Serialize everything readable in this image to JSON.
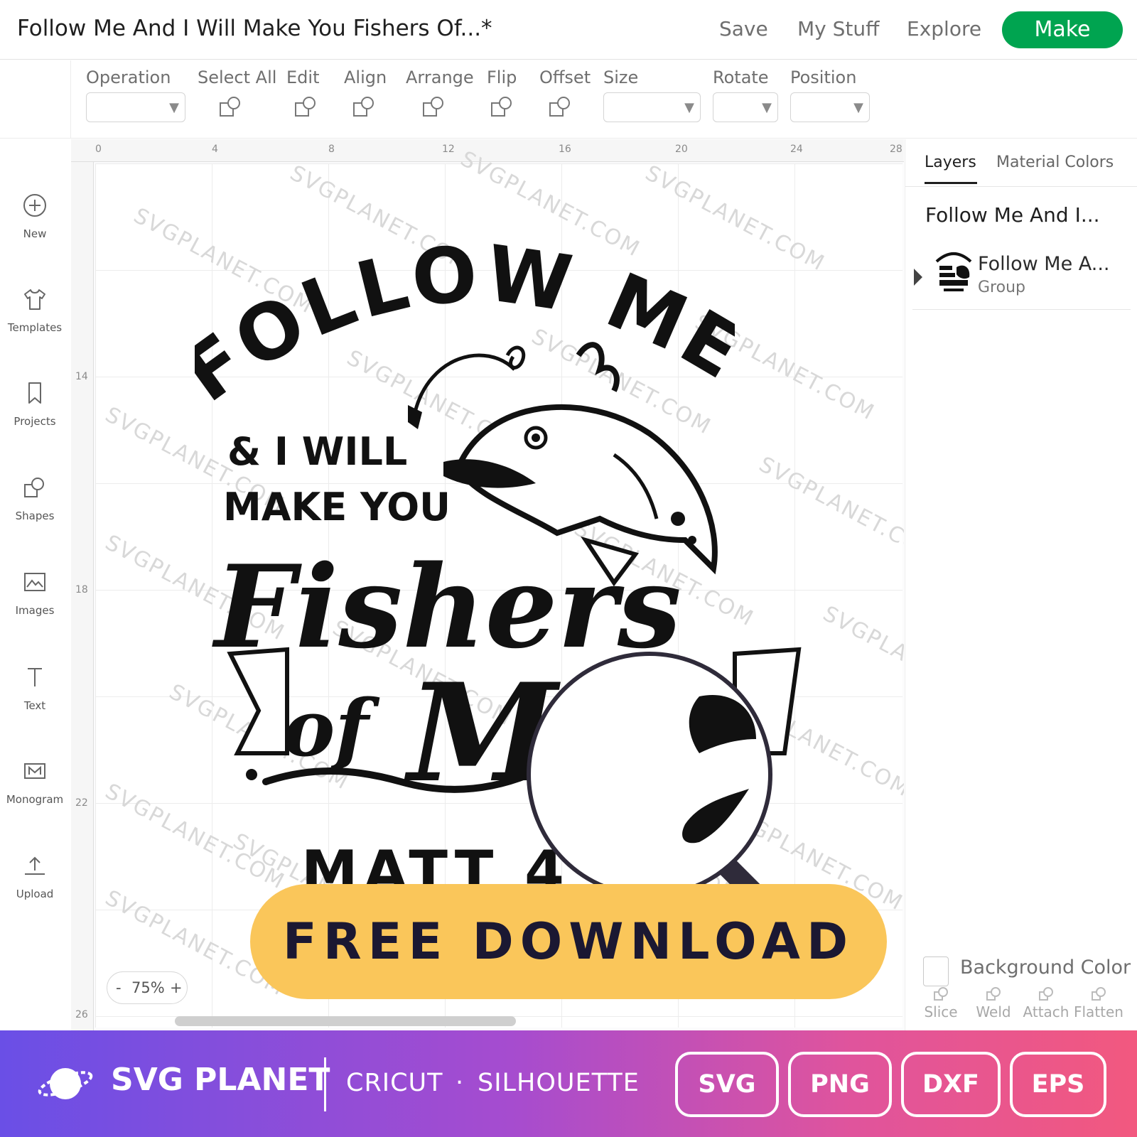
{
  "header": {
    "title": "Follow Me And I Will Make You Fishers Of...*",
    "nav": [
      "Save",
      "My Stuff",
      "Explore"
    ],
    "make_label": "Make",
    "accent_color": "#00a450"
  },
  "toolbar": {
    "labels": [
      "Operation",
      "Select All",
      "Edit",
      "Align",
      "Arrange",
      "Flip",
      "Offset",
      "Size",
      "Rotate",
      "Position"
    ]
  },
  "sidebar": {
    "items": [
      {
        "label": "New",
        "icon": "plus-circle-icon"
      },
      {
        "label": "Templates",
        "icon": "shirt-icon"
      },
      {
        "label": "Projects",
        "icon": "bookmark-icon"
      },
      {
        "label": "Shapes",
        "icon": "shapes-icon"
      },
      {
        "label": "Images",
        "icon": "image-icon"
      },
      {
        "label": "Text",
        "icon": "text-icon"
      },
      {
        "label": "Monogram",
        "icon": "monogram-icon"
      },
      {
        "label": "Upload",
        "icon": "upload-icon"
      }
    ]
  },
  "canvas": {
    "ruler_top": [
      "0",
      "4",
      "8",
      "12",
      "16",
      "20",
      "24",
      "28"
    ],
    "ruler_left": [
      "14",
      "18",
      "22",
      "26"
    ],
    "watermark": "SVGPLANET.COM",
    "zoom": "75%",
    "zoom_minus": "-",
    "zoom_plus": "+",
    "design": {
      "line1": "FOLLOW ME",
      "line2": "& I WILL",
      "line3": "MAKE YOU",
      "line4": "Fishers",
      "line5": "of",
      "line6": "M",
      "line7": "MATT 4"
    }
  },
  "panel": {
    "tabs": [
      "Layers",
      "Material Colors"
    ],
    "layer_group_title": "Follow Me And I...",
    "layer": {
      "name": "Follow Me A...",
      "type": "Group"
    },
    "background_color_label": "Background Color",
    "tools": [
      "Slice",
      "Weld",
      "Attach",
      "Flatten"
    ]
  },
  "cta": {
    "label": "FREE DOWNLOAD",
    "color": "#fac65a"
  },
  "banner": {
    "brand": "SVG PLANET",
    "compat_1": "CRICUT",
    "dot": "·",
    "compat_2": "SILHOUETTE",
    "formats": [
      "SVG",
      "PNG",
      "DXF",
      "EPS"
    ]
  }
}
